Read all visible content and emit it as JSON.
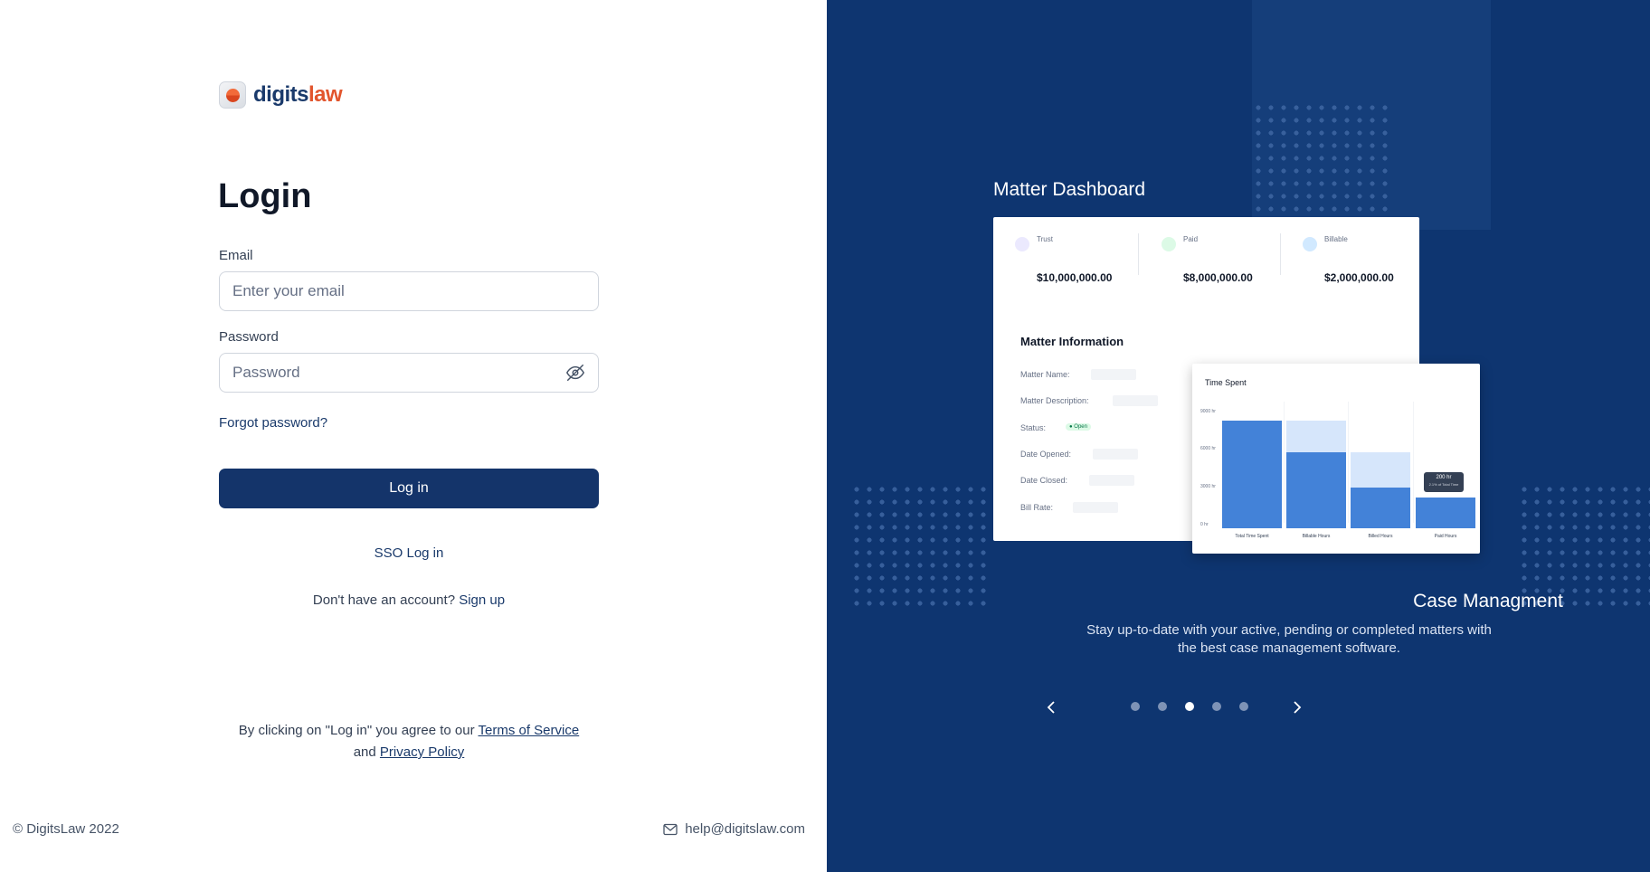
{
  "brand": {
    "name_part1": "digits",
    "name_part2": "law"
  },
  "login": {
    "title": "Login",
    "email_label": "Email",
    "email_placeholder": "Enter your email",
    "password_label": "Password",
    "password_placeholder": "Password",
    "forgot": "Forgot password?",
    "submit": "Log in",
    "sso": "SSO Log in",
    "signup_prompt": "Don't have an account?",
    "signup_link": "Sign up",
    "terms_prefix": "By clicking on \"Log in\" you agree to our",
    "terms_link": "Terms of Service",
    "terms_and": "and",
    "privacy_link": "Privacy Policy"
  },
  "footer": {
    "copyright": "© DigitsLaw 2022",
    "email": "help@digitslaw.com"
  },
  "showcase": {
    "dashboard_title": "Matter Dashboard",
    "stats": [
      {
        "label": "Trust",
        "value": "$10,000,000.00",
        "color": "#d9d6fe"
      },
      {
        "label": "Paid",
        "value": "$8,000,000.00",
        "color": "#d1fadf"
      },
      {
        "label": "Billable",
        "value": "$2,000,000.00",
        "color": "#d1e9ff"
      }
    ],
    "matter_info_title": "Matter Information",
    "matter_fields": [
      "Matter Name:",
      "Matter Description:",
      "Status:",
      "Date Opened:",
      "Date Closed:",
      "Bill Rate:"
    ],
    "status_badge": "Open",
    "time_spent": {
      "title": "Time Spent",
      "y_ticks": [
        "9000 hr",
        "6000 hr",
        "3000 hr",
        "0 hr"
      ],
      "categories": [
        "Total Time Spent",
        "Billable Hours",
        "Billed Hours",
        "Paid Hours"
      ],
      "values": [
        8500,
        6000,
        3200,
        2400
      ],
      "totals": [
        8500,
        8500,
        6000,
        2400
      ],
      "tooltip_value": "200 hr",
      "tooltip_sub": "2.1% of Total Time"
    },
    "feature_title": "Case Managment",
    "feature_text": "Stay up-to-date with your active, pending or completed matters with the best case management software.",
    "carousel": {
      "count": 5,
      "active": 2
    }
  },
  "colors": {
    "primary": "#14346a",
    "panel": "#0e3570",
    "accent": "#e2552d"
  }
}
